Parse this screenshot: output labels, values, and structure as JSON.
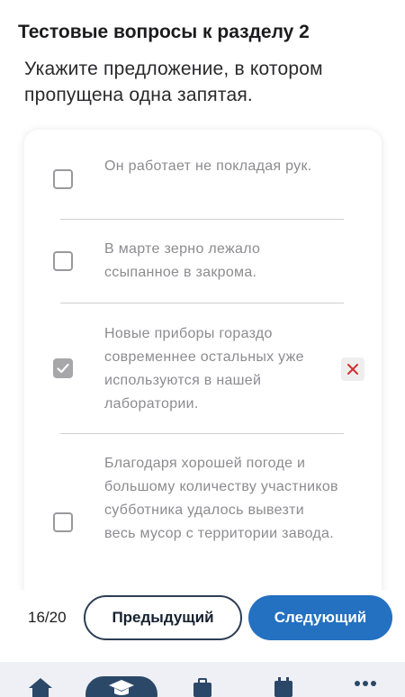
{
  "header": {
    "title": "Тестовые вопросы к разделу 2"
  },
  "question": {
    "text": "Укажите предложение, в котором пропущена одна запятая."
  },
  "options": [
    {
      "text": "Он работает не покладая рук.",
      "checked": false
    },
    {
      "text": "В марте зерно лежало ссыпанное в закрома.",
      "checked": false
    },
    {
      "text": "Новые приборы гораздо современнее остальных уже используются в нашей лаборатории.",
      "checked": true,
      "status": "wrong"
    },
    {
      "text": "Благодаря хорошей погоде и большому количеству участников субботника удалось вывезти весь мусор с территории завода.",
      "checked": false
    }
  ],
  "footer": {
    "counter": "16/20",
    "prev_label": "Предыдущий",
    "next_label": "Следующий"
  },
  "bottom_nav": {
    "items": [
      {
        "icon": "home-icon",
        "active": false
      },
      {
        "icon": "graduation-cap-icon",
        "active": true
      },
      {
        "icon": "briefcase-icon",
        "active": false
      },
      {
        "icon": "calendar-icon",
        "active": false
      },
      {
        "icon": "more-icon",
        "active": false
      }
    ]
  },
  "colors": {
    "accent": "#2470c1",
    "nav_active": "#2c4868",
    "wrong": "#d0312d",
    "option_text": "#8c8c90"
  }
}
